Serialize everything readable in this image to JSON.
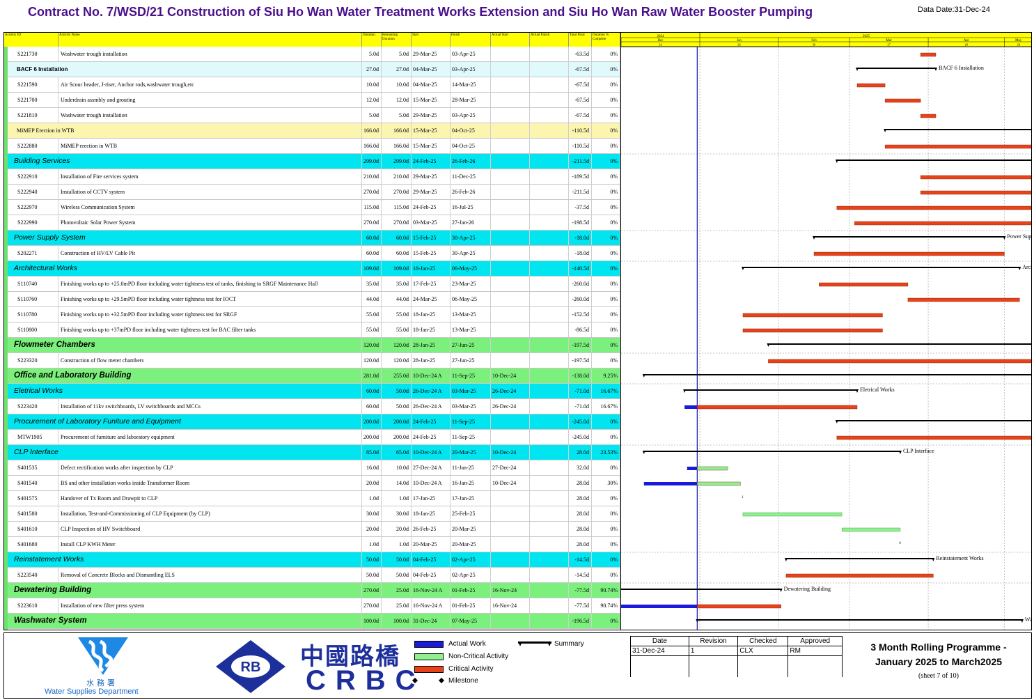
{
  "title": "Contract No. 7/WSD/21 Construction of Siu Ho Wan Water Treatment Works Extension and Siu Ho Wan Raw Water Booster Pumping",
  "data_date": "Data Date:31-Dec-24",
  "columns": {
    "activity_id": "Activity ID",
    "activity_name": "Activity Name",
    "duration": "Duration",
    "remaining_duration": "Remaining Duration",
    "start": "Start",
    "finish": "Finish",
    "actual_start": "Actual Start",
    "actual_finish": "Actual Finish",
    "total_float": "Total Float",
    "pct_complete": "Duration % Complete"
  },
  "timescale": {
    "years": [
      "2024",
      "2025"
    ],
    "months": [
      "Dec",
      "Jan",
      "Feb",
      "Mar",
      "Apr",
      "May"
    ],
    "weeks": [
      "24",
      "26",
      "30",
      "27",
      "28",
      "28"
    ]
  },
  "rows": [
    {
      "type": "task",
      "id": "S221730",
      "name": "Washwater trough installation",
      "dur": "5.0d",
      "rem": "5.0d",
      "start": "29-Mar-25",
      "finish": "03-Apr-25",
      "astart": "",
      "afinish": "",
      "tf": "-63.5d",
      "pct": "0%"
    },
    {
      "type": "sub",
      "id": "",
      "name": "BACF 6 Installation",
      "dur": "27.0d",
      "rem": "27.0d",
      "start": "04-Mar-25",
      "finish": "03-Apr-25",
      "astart": "",
      "afinish": "",
      "tf": "-67.5d",
      "pct": "0%"
    },
    {
      "type": "task",
      "id": "S221590",
      "name": "Air Scour header, J-riser, Anchor rods,washwater trough,etc",
      "dur": "10.0d",
      "rem": "10.0d",
      "start": "04-Mar-25",
      "finish": "14-Mar-25",
      "astart": "",
      "afinish": "",
      "tf": "-67.5d",
      "pct": "0%"
    },
    {
      "type": "task",
      "id": "S221700",
      "name": "Underdrain assmbly and grouting",
      "dur": "12.0d",
      "rem": "12.0d",
      "start": "15-Mar-25",
      "finish": "28-Mar-25",
      "astart": "",
      "afinish": "",
      "tf": "-67.5d",
      "pct": "0%"
    },
    {
      "type": "task",
      "id": "S221810",
      "name": "Washwater trough installation",
      "dur": "5.0d",
      "rem": "5.0d",
      "start": "29-Mar-25",
      "finish": "03-Apr-25",
      "astart": "",
      "afinish": "",
      "tf": "-67.5d",
      "pct": "0%"
    },
    {
      "type": "sub-yellow",
      "id": "",
      "name": "MiMEP Erection in WTB",
      "dur": "166.0d",
      "rem": "166.0d",
      "start": "15-Mar-25",
      "finish": "04-Oct-25",
      "astart": "",
      "afinish": "",
      "tf": "-110.5d",
      "pct": "0%"
    },
    {
      "type": "task",
      "id": "S222880",
      "name": "MiMEP erection in WTB",
      "dur": "166.0d",
      "rem": "166.0d",
      "start": "15-Mar-25",
      "finish": "04-Oct-25",
      "astart": "",
      "afinish": "",
      "tf": "-110.5d",
      "pct": "0%"
    },
    {
      "type": "wbs",
      "id": "",
      "name": "Building Services",
      "dur": "299.0d",
      "rem": "299.0d",
      "start": "24-Feb-25",
      "finish": "26-Feb-26",
      "astart": "",
      "afinish": "",
      "tf": "-211.5d",
      "pct": "0%"
    },
    {
      "type": "task",
      "id": "S222910",
      "name": "Installation of Fire services system",
      "dur": "210.0d",
      "rem": "210.0d",
      "start": "29-Mar-25",
      "finish": "11-Dec-25",
      "astart": "",
      "afinish": "",
      "tf": "-189.5d",
      "pct": "0%"
    },
    {
      "type": "task",
      "id": "S222940",
      "name": "Installation of CCTV system",
      "dur": "270.0d",
      "rem": "270.0d",
      "start": "29-Mar-25",
      "finish": "26-Feb-26",
      "astart": "",
      "afinish": "",
      "tf": "-211.5d",
      "pct": "0%"
    },
    {
      "type": "task",
      "id": "S222970",
      "name": "Wireless Communication System",
      "dur": "115.0d",
      "rem": "115.0d",
      "start": "24-Feb-25",
      "finish": "16-Jul-25",
      "astart": "",
      "afinish": "",
      "tf": "-37.5d",
      "pct": "0%"
    },
    {
      "type": "task",
      "id": "S222990",
      "name": "Photovoltaic Solar Power System",
      "dur": "270.0d",
      "rem": "270.0d",
      "start": "03-Mar-25",
      "finish": "27-Jan-26",
      "astart": "",
      "afinish": "",
      "tf": "-198.5d",
      "pct": "0%"
    },
    {
      "type": "wbs",
      "id": "",
      "name": "Power Supply System",
      "dur": "60.0d",
      "rem": "60.0d",
      "start": "15-Feb-25",
      "finish": "30-Apr-25",
      "astart": "",
      "afinish": "",
      "tf": "-18.0d",
      "pct": "0%"
    },
    {
      "type": "task",
      "id": "S202271",
      "name": "Construction of HV/LV Cable Pit",
      "dur": "60.0d",
      "rem": "60.0d",
      "start": "15-Feb-25",
      "finish": "30-Apr-25",
      "astart": "",
      "afinish": "",
      "tf": "-18.0d",
      "pct": "0%"
    },
    {
      "type": "wbs",
      "id": "",
      "name": "Architectural Works",
      "dur": "109.0d",
      "rem": "109.0d",
      "start": "18-Jan-25",
      "finish": "06-May-25",
      "astart": "",
      "afinish": "",
      "tf": "-140.5d",
      "pct": "0%"
    },
    {
      "type": "task",
      "id": "S110740",
      "name": "Finishing works up to +25.0mPD floor including water tightness test of tanks, finishing to SRGF Maintenance Hall",
      "dur": "35.0d",
      "rem": "35.0d",
      "start": "17-Feb-25",
      "finish": "23-Mar-25",
      "astart": "",
      "afinish": "",
      "tf": "-260.0d",
      "pct": "0%"
    },
    {
      "type": "task",
      "id": "S110760",
      "name": "Finishing works up to +29.5mPD floor including water tightness test for IOCT",
      "dur": "44.0d",
      "rem": "44.0d",
      "start": "24-Mar-25",
      "finish": "06-May-25",
      "astart": "",
      "afinish": "",
      "tf": "-260.0d",
      "pct": "0%"
    },
    {
      "type": "task",
      "id": "S110780",
      "name": "Finishing works up to +32.5mPD floor including water tightness test for SRGF",
      "dur": "55.0d",
      "rem": "55.0d",
      "start": "18-Jan-25",
      "finish": "13-Mar-25",
      "astart": "",
      "afinish": "",
      "tf": "-152.5d",
      "pct": "0%"
    },
    {
      "type": "task",
      "id": "S110800",
      "name": "Finishing works up to +37mPD floor including water tightness test for BAC filter tanks",
      "dur": "55.0d",
      "rem": "55.0d",
      "start": "18-Jan-25",
      "finish": "13-Mar-25",
      "astart": "",
      "afinish": "",
      "tf": "-86.5d",
      "pct": "0%"
    },
    {
      "type": "wbs-big",
      "id": "",
      "name": "Flowmeter Chambers",
      "dur": "120.0d",
      "rem": "120.0d",
      "start": "28-Jan-25",
      "finish": "27-Jun-25",
      "astart": "",
      "afinish": "",
      "tf": "-197.5d",
      "pct": "0%"
    },
    {
      "type": "task",
      "id": "S223320",
      "name": "Construction of flow meter chambers",
      "dur": "120.0d",
      "rem": "120.0d",
      "start": "28-Jan-25",
      "finish": "27-Jun-25",
      "astart": "",
      "afinish": "",
      "tf": "-197.5d",
      "pct": "0%"
    },
    {
      "type": "wbs-big",
      "id": "",
      "name": "Office and Laboratory Building",
      "dur": "281.0d",
      "rem": "255.0d",
      "start": "10-Dec-24 A",
      "finish": "11-Sep-25",
      "astart": "10-Dec-24",
      "afinish": "",
      "tf": "-138.0d",
      "pct": "9.25%"
    },
    {
      "type": "wbs",
      "id": "",
      "name": "Eletrical Works",
      "dur": "60.0d",
      "rem": "50.0d",
      "start": "26-Dec-24 A",
      "finish": "03-Mar-25",
      "astart": "26-Dec-24",
      "afinish": "",
      "tf": "-71.0d",
      "pct": "16.67%"
    },
    {
      "type": "task",
      "id": "S223420",
      "name": "Installation of 11kv switchboards, LV switchboards and MCCs",
      "dur": "60.0d",
      "rem": "50.0d",
      "start": "26-Dec-24 A",
      "finish": "03-Mar-25",
      "astart": "26-Dec-24",
      "afinish": "",
      "tf": "-71.0d",
      "pct": "16.67%"
    },
    {
      "type": "wbs",
      "id": "",
      "name": "Procurement of Laboratory Funiture and Equipment",
      "dur": "200.0d",
      "rem": "200.0d",
      "start": "24-Feb-25",
      "finish": "11-Sep-25",
      "astart": "",
      "afinish": "",
      "tf": "-245.0d",
      "pct": "0%"
    },
    {
      "type": "task",
      "id": "MTW1905",
      "name": "Procurement of furniture and laboratory equipment",
      "dur": "200.0d",
      "rem": "200.0d",
      "start": "24-Feb-25",
      "finish": "11-Sep-25",
      "astart": "",
      "afinish": "",
      "tf": "-245.0d",
      "pct": "0%"
    },
    {
      "type": "wbs",
      "id": "",
      "name": "CLP Interface",
      "dur": "85.0d",
      "rem": "65.0d",
      "start": "10-Dec-24 A",
      "finish": "20-Mar-25",
      "astart": "10-Dec-24",
      "afinish": "",
      "tf": "28.0d",
      "pct": "23.53%"
    },
    {
      "type": "task",
      "id": "S401535",
      "name": "Defect rectification works after inspection by CLP",
      "dur": "16.0d",
      "rem": "10.0d",
      "start": "27-Dec-24 A",
      "finish": "11-Jan-25",
      "astart": "27-Dec-24",
      "afinish": "",
      "tf": "32.0d",
      "pct": "0%"
    },
    {
      "type": "task",
      "id": "S401540",
      "name": "BS and other installation works inside Transformer Room",
      "dur": "20.0d",
      "rem": "14.0d",
      "start": "10-Dec-24 A",
      "finish": "16-Jan-25",
      "astart": "10-Dec-24",
      "afinish": "",
      "tf": "28.0d",
      "pct": "30%"
    },
    {
      "type": "task",
      "id": "S401575",
      "name": "Handover of Tx Room and Drawpit to CLP",
      "dur": "1.0d",
      "rem": "1.0d",
      "start": "17-Jan-25",
      "finish": "17-Jan-25",
      "astart": "",
      "afinish": "",
      "tf": "28.0d",
      "pct": "0%"
    },
    {
      "type": "task",
      "id": "S401580",
      "name": "Installation, Test-and-Commissioning of CLP Equipment (by CLP)",
      "dur": "30.0d",
      "rem": "30.0d",
      "start": "18-Jan-25",
      "finish": "25-Feb-25",
      "astart": "",
      "afinish": "",
      "tf": "28.0d",
      "pct": "0%"
    },
    {
      "type": "task",
      "id": "S401610",
      "name": "CLP Inspection of HV Switchboard",
      "dur": "20.0d",
      "rem": "20.0d",
      "start": "26-Feb-25",
      "finish": "20-Mar-25",
      "astart": "",
      "afinish": "",
      "tf": "28.0d",
      "pct": "0%"
    },
    {
      "type": "task",
      "id": "S401680",
      "name": "Install CLP KWH Meter",
      "dur": "1.0d",
      "rem": "1.0d",
      "start": "20-Mar-25",
      "finish": "20-Mar-25",
      "astart": "",
      "afinish": "",
      "tf": "28.0d",
      "pct": "0%"
    },
    {
      "type": "wbs",
      "id": "",
      "name": "Reinstatement Works",
      "dur": "50.0d",
      "rem": "50.0d",
      "start": "04-Feb-25",
      "finish": "02-Apr-25",
      "astart": "",
      "afinish": "",
      "tf": "-14.5d",
      "pct": "0%"
    },
    {
      "type": "task",
      "id": "S223540",
      "name": "Removal of Concrete Blocks and Dismantling ELS",
      "dur": "50.0d",
      "rem": "50.0d",
      "start": "04-Feb-25",
      "finish": "02-Apr-25",
      "astart": "",
      "afinish": "",
      "tf": "-14.5d",
      "pct": "0%"
    },
    {
      "type": "wbs-big",
      "id": "",
      "name": "Dewatering Building",
      "dur": "270.0d",
      "rem": "25.0d",
      "start": "16-Nov-24 A",
      "finish": "01-Feb-25",
      "astart": "16-Nov-24",
      "afinish": "",
      "tf": "-77.5d",
      "pct": "90.74%"
    },
    {
      "type": "task",
      "id": "S223610",
      "name": "Installation of new filter press system",
      "dur": "270.0d",
      "rem": "25.0d",
      "start": "16-Nov-24 A",
      "finish": "01-Feb-25",
      "astart": "16-Nov-24",
      "afinish": "",
      "tf": "-77.5d",
      "pct": "90.74%"
    },
    {
      "type": "wbs-big",
      "id": "",
      "name": "Washwater System",
      "dur": "100.0d",
      "rem": "100.0d",
      "start": "31-Dec-24",
      "finish": "07-May-25",
      "astart": "",
      "afinish": "",
      "tf": "-196.5d",
      "pct": "0%"
    }
  ],
  "bar_labels": {
    "1": "BACF 6 Installation",
    "12": "Power Supp",
    "14": "Arch",
    "22": "Eletrical Works",
    "26": "CLP Interface",
    "33": "Reinstatement Works",
    "35": "Dewatering Building",
    "37": "Was"
  },
  "milestone_marks": {
    "29": "1",
    "32": "0"
  },
  "legend": {
    "actual": "Actual Work",
    "non_critical": "Non-Critical Activity",
    "critical": "Critical Activity",
    "milestone": "Milestone",
    "summary": "Summary"
  },
  "revision_table": {
    "headers": [
      "Date",
      "Revision",
      "Checked",
      "Approved"
    ],
    "row": [
      "31-Dec-24",
      "1",
      "CLX",
      "RM"
    ]
  },
  "programme_title": "3 Month Rolling Programme - January 2025 to March2025",
  "sheet_no": "(sheet 7 of 10)",
  "wsd": {
    "name": "Water Supplies Department",
    "chinese": "水務署"
  },
  "crbc": {
    "chinese": "中國路橋",
    "english": "CRBC",
    "logo_text": "RB"
  },
  "colors": {
    "title": "#4a0f8c",
    "header": "#ffff00",
    "wbs_cyan": "#00e5ef",
    "wbs_green": "#7cf07c",
    "sub_cyan": "#e0fafc",
    "sub_yellow": "#fbf5b0",
    "critical": "#e8421a",
    "non_critical": "#8ef08e",
    "actual": "#1a1adc"
  }
}
